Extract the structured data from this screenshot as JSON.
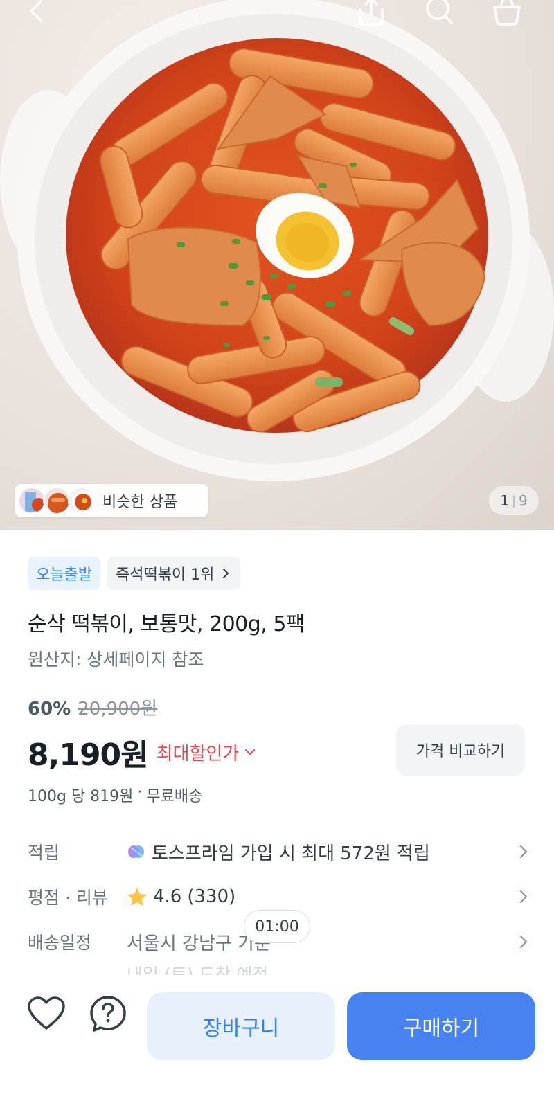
{
  "header": {
    "back_icon": "chevron-left-icon",
    "share_icon": "share-upload-icon",
    "search_icon": "search-icon",
    "cart_icon": "shopping-bag-icon"
  },
  "gallery": {
    "similar_products_label": "비슷한 상품",
    "current_page": "1",
    "page_separator": "|",
    "total_pages": "9"
  },
  "badges": {
    "delivery": "오늘출발",
    "ranking": "즉석떡볶이 1위"
  },
  "product": {
    "title": "순삭 떡볶이, 보통맛, 200g, 5팩",
    "origin": "원산지: 상세페이지 참조"
  },
  "pricing": {
    "discount_rate": "60%",
    "original_price": "20,900원",
    "price": "8,190원",
    "max_discount_label": "최대할인가",
    "compare_button": "가격 비교하기",
    "unit_price": "100g 당 819원",
    "separator": "·",
    "shipping": "무료배송"
  },
  "info_rows": {
    "points": {
      "label": "적립",
      "value": "토스프라임 가입 시 최대 572원 적립"
    },
    "rating": {
      "label": "평점 · 리뷰",
      "score": "4.6",
      "count": "(330)"
    },
    "delivery": {
      "label": "배송일정",
      "value": "서울시 강남구 기준",
      "subtext": "내일 (토) 도착 예정"
    }
  },
  "timer_chip": "01:00",
  "bottom_bar": {
    "like_icon": "heart-icon",
    "help_icon": "question-circle-icon",
    "cart_button": "장바구니",
    "buy_button": "구매하기"
  },
  "colors": {
    "accent_blue": "#3182f6",
    "buy_button": "#4683f0",
    "cart_button_bg": "#e8f0fc",
    "discount_red": "#f04452",
    "star_yellow": "#ffc342",
    "text_primary": "#191f28",
    "text_secondary": "#6b7684"
  }
}
